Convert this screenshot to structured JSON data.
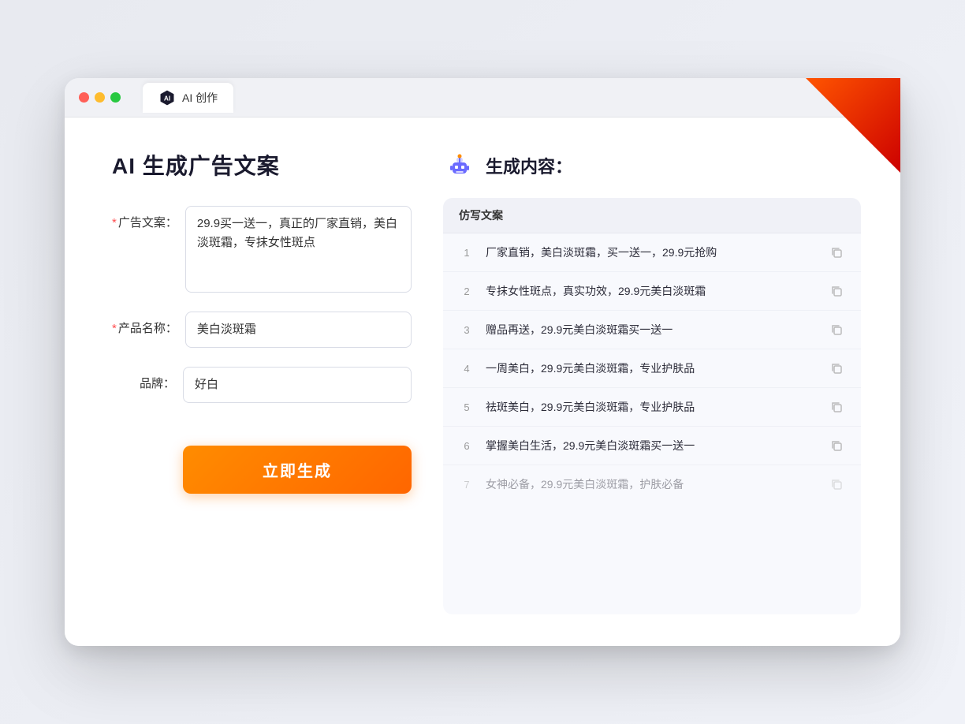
{
  "browser": {
    "tab_label": "AI 创作"
  },
  "page": {
    "title": "AI 生成广告文案"
  },
  "form": {
    "ad_copy_label": "广告文案：",
    "ad_copy_required": "*",
    "ad_copy_value": "29.9买一送一，真正的厂家直销，美白淡斑霜，专抹女性斑点",
    "product_name_label": "产品名称：",
    "product_name_required": "*",
    "product_name_value": "美白淡斑霜",
    "brand_label": "品牌：",
    "brand_value": "好白",
    "generate_button": "立即生成"
  },
  "result": {
    "title": "生成内容：",
    "column_header": "仿写文案",
    "items": [
      {
        "num": "1",
        "text": "厂家直销，美白淡斑霜，买一送一，29.9元抢购"
      },
      {
        "num": "2",
        "text": "专抹女性斑点，真实功效，29.9元美白淡斑霜"
      },
      {
        "num": "3",
        "text": "赠品再送，29.9元美白淡斑霜买一送一"
      },
      {
        "num": "4",
        "text": "一周美白，29.9元美白淡斑霜，专业护肤品"
      },
      {
        "num": "5",
        "text": "祛斑美白，29.9元美白淡斑霜，专业护肤品"
      },
      {
        "num": "6",
        "text": "掌握美白生活，29.9元美白淡斑霜买一送一"
      },
      {
        "num": "7",
        "text": "女神必备，29.9元美白淡斑霜，护肤必备"
      }
    ]
  }
}
